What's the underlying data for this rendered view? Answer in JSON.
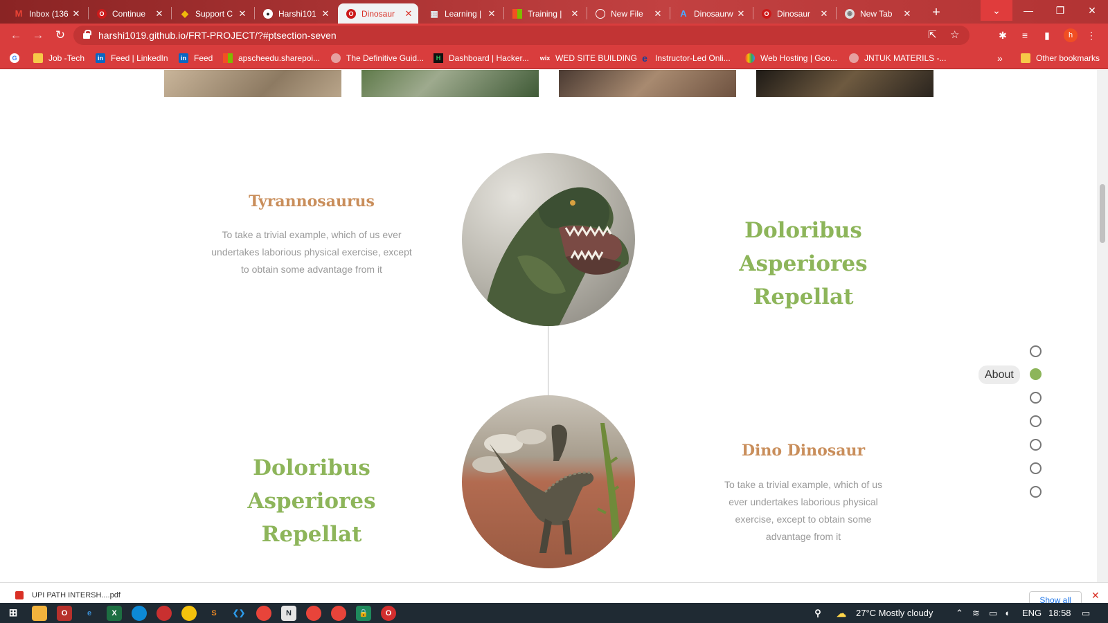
{
  "browser": {
    "tabs": [
      {
        "title": "Inbox (136",
        "icon": "gmail-icon",
        "color": "#ea4335",
        "glyph": "M"
      },
      {
        "title": "Continue",
        "icon": "opera-icon",
        "color": "#cc1a1a",
        "glyph": "O"
      },
      {
        "title": "Support C",
        "icon": "binance-icon",
        "color": "#f0b90b",
        "glyph": "◆"
      },
      {
        "title": "Harshi101",
        "icon": "github-icon",
        "color": "#222222",
        "glyph": "●"
      },
      {
        "title": "Dinosaur",
        "icon": "opera-icon",
        "color": "#cc1a1a",
        "glyph": "O"
      },
      {
        "title": "Learning |",
        "icon": "learning-icon",
        "color": "#5f7a8a",
        "glyph": "▦"
      },
      {
        "title": "Training |",
        "icon": "microsoft-icon",
        "color": "#f25022",
        "glyph": "■"
      },
      {
        "title": "New File",
        "icon": "blank-page-icon",
        "color": "#ffffff",
        "glyph": ""
      },
      {
        "title": "Dinosaurw",
        "icon": "azure-icon",
        "color": "#0078d4",
        "glyph": "A"
      },
      {
        "title": "Dinosaur",
        "icon": "opera-icon",
        "color": "#cc1a1a",
        "glyph": "O"
      },
      {
        "title": "New Tab",
        "icon": "chrome-icon",
        "color": "#9aa0a6",
        "glyph": "◉"
      }
    ],
    "active_tab_index": 4,
    "url": "harshi1019.github.io/FRT-PROJECT/?#ptsection-seven",
    "profile_initial": "h",
    "bookmarks": [
      {
        "label": "Job -Tech",
        "icon": "folder-icon"
      },
      {
        "label": "Feed | LinkedIn",
        "icon": "linkedin-icon"
      },
      {
        "label": "Feed",
        "icon": "linkedin-icon"
      },
      {
        "label": "apscheedu.sharepoi...",
        "icon": "microsoft-icon"
      },
      {
        "label": "The Definitive Guid...",
        "icon": "globe-icon"
      },
      {
        "label": "Dashboard | Hacker...",
        "icon": "hackerrank-icon"
      },
      {
        "label": "WED SITE BUILDING",
        "icon": "wix-icon"
      },
      {
        "label": "Instructor-Led Onli...",
        "icon": "edureka-icon"
      },
      {
        "label": "Web Hosting | Goo...",
        "icon": "google-cloud-icon"
      },
      {
        "label": "JNTUK MATERILS -...",
        "icon": "globe-icon"
      }
    ],
    "other_bookmarks": "Other bookmarks"
  },
  "page": {
    "section1": {
      "title": "Tyrannosaurus",
      "text": "To take a trivial example, which of us ever undertakes laborious physical exercise, except to obtain some advantage from it",
      "big_title": "Doloribus Asperiores Repellat"
    },
    "section2": {
      "title": "Dino Dinosaur",
      "text": "To take a trivial example, which of us ever undertakes laborious physical exercise, except to obtain some advantage from it",
      "big_title": "Doloribus Asperiores Repellat"
    },
    "dot_nav": {
      "label": "About",
      "count": 7,
      "active_index": 1
    },
    "accent_green": "#8db55a",
    "accent_brown": "#c98e5b"
  },
  "downloads": {
    "file": "UPI PATH INTERSH....pdf",
    "show_all": "Show all"
  },
  "taskbar": {
    "weather": "27°C  Mostly cloudy",
    "language": "ENG",
    "time": "18:58"
  }
}
